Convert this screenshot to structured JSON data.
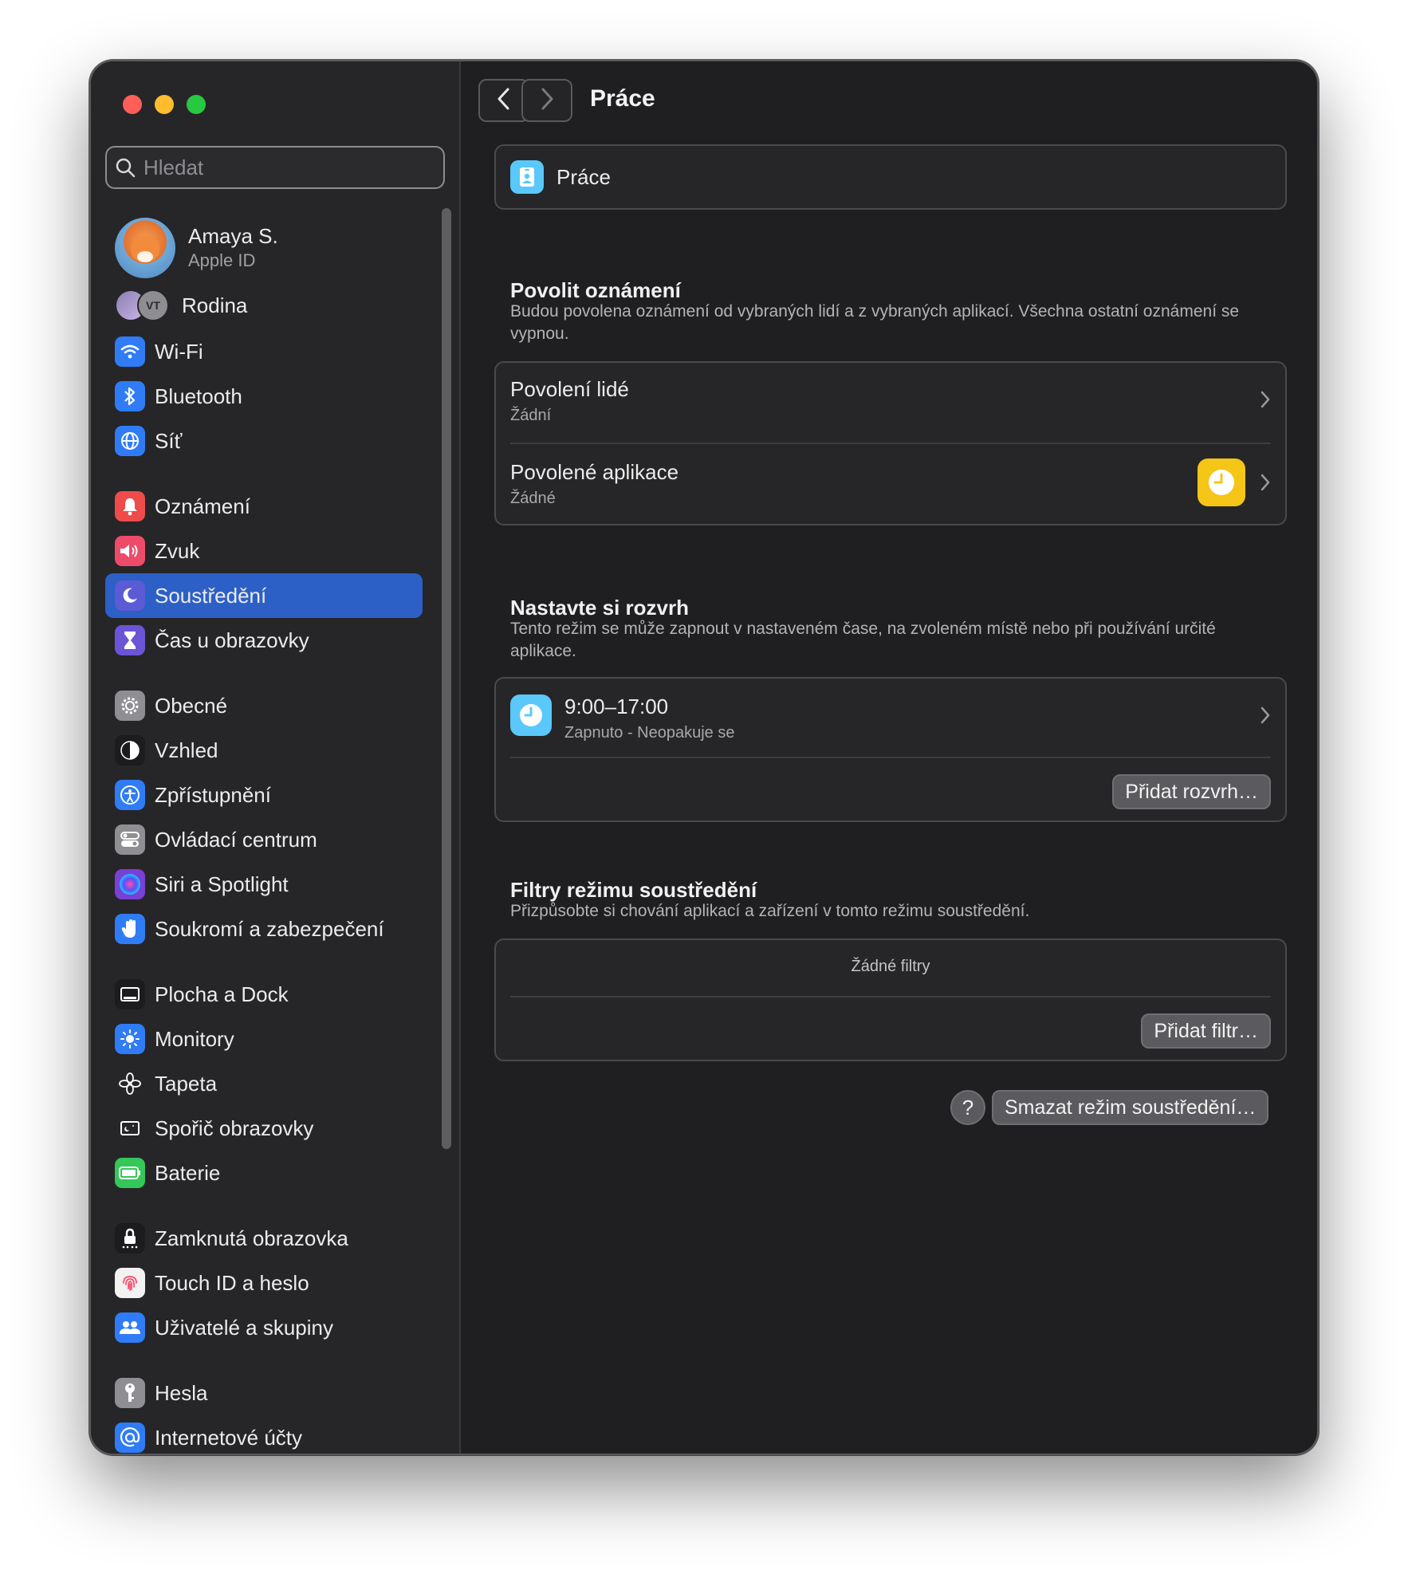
{
  "search": {
    "placeholder": "Hledat"
  },
  "profile": {
    "name": "Amaya S.",
    "subtitle": "Apple ID"
  },
  "family": {
    "label": "Rodina",
    "avatar_initials": "VT"
  },
  "sidebar": {
    "items": [
      {
        "label": "Wi-Fi",
        "icon": "wifi-icon",
        "color": "#2f7cf6"
      },
      {
        "label": "Bluetooth",
        "icon": "bluetooth-icon",
        "color": "#2f7cf6"
      },
      {
        "label": "Síť",
        "icon": "globe-icon",
        "color": "#2f7cf6"
      },
      {
        "label": "Oznámení",
        "icon": "bell-icon",
        "color": "#ee4b4b"
      },
      {
        "label": "Zvuk",
        "icon": "speaker-icon",
        "color": "#ee4b6a"
      },
      {
        "label": "Soustředění",
        "icon": "moon-icon",
        "color": "#5b5bd6",
        "active": true
      },
      {
        "label": "Čas u obrazovky",
        "icon": "hourglass-icon",
        "color": "#6b55d6"
      },
      {
        "label": "Obecné",
        "icon": "gear-icon",
        "color": "#8e8e93"
      },
      {
        "label": "Vzhled",
        "icon": "appearance-icon",
        "color": "#1c1c1e"
      },
      {
        "label": "Zpřístupnění",
        "icon": "accessibility-icon",
        "color": "#2f7cf6"
      },
      {
        "label": "Ovládací centrum",
        "icon": "toggles-icon",
        "color": "#8e8e93"
      },
      {
        "label": "Siri a Spotlight",
        "icon": "siri-icon",
        "color": "#7a3fd6"
      },
      {
        "label": "Soukromí a zabezpečení",
        "icon": "hand-icon",
        "color": "#2f7cf6"
      },
      {
        "label": "Plocha a Dock",
        "icon": "dock-icon",
        "color": "#1c1c1e"
      },
      {
        "label": "Monitory",
        "icon": "sun-icon",
        "color": "#2f7cf6"
      },
      {
        "label": "Tapeta",
        "icon": "flower-icon",
        "color": "#262628"
      },
      {
        "label": "Spořič obrazovky",
        "icon": "screensaver-icon",
        "color": "#262628"
      },
      {
        "label": "Baterie",
        "icon": "battery-icon",
        "color": "#34c759"
      },
      {
        "label": "Zamknutá obrazovka",
        "icon": "lock-icon",
        "color": "#1c1c1e"
      },
      {
        "label": "Touch ID a heslo",
        "icon": "fingerprint-icon",
        "color": "#f2f2f2"
      },
      {
        "label": "Uživatelé a skupiny",
        "icon": "users-icon",
        "color": "#2f7cf6"
      },
      {
        "label": "Hesla",
        "icon": "key-icon",
        "color": "#8e8e93"
      },
      {
        "label": "Internetové účty",
        "icon": "at-icon",
        "color": "#2f7cf6"
      }
    ]
  },
  "header": {
    "title": "Práce"
  },
  "focus": {
    "name": "Práce",
    "icon": "id-badge-icon",
    "icon_color": "#5ac8fa"
  },
  "notifications": {
    "title": "Povolit oznámení",
    "description": "Budou povolena oznámení od vybraných lidí a z vybraných aplikací. Všechna ostatní oznámení se vypnou.",
    "people_title": "Povolení lidé",
    "people_value": "Žádní",
    "apps_title": "Povolené aplikace",
    "apps_value": "Žádné",
    "apps_icon_color": "#f5c518"
  },
  "schedule": {
    "title": "Nastavte si rozvrh",
    "description": "Tento režim se může zapnout v nastaveném čase, na zvoleném místě nebo při používání určité aplikace.",
    "item_time": "9:00–17:00",
    "item_status": "Zapnuto - Neopakuje se",
    "item_icon_color": "#5ac8fa",
    "add_button": "Přidat rozvrh…"
  },
  "filters": {
    "title": "Filtry režimu soustředění",
    "description": "Přizpůsobte si chování aplikací a zařízení v tomto režimu soustředění.",
    "empty_text": "Žádné filtry",
    "add_button": "Přidat filtr…"
  },
  "footer": {
    "help_label": "?",
    "delete_button": "Smazat režim soustředění…"
  }
}
